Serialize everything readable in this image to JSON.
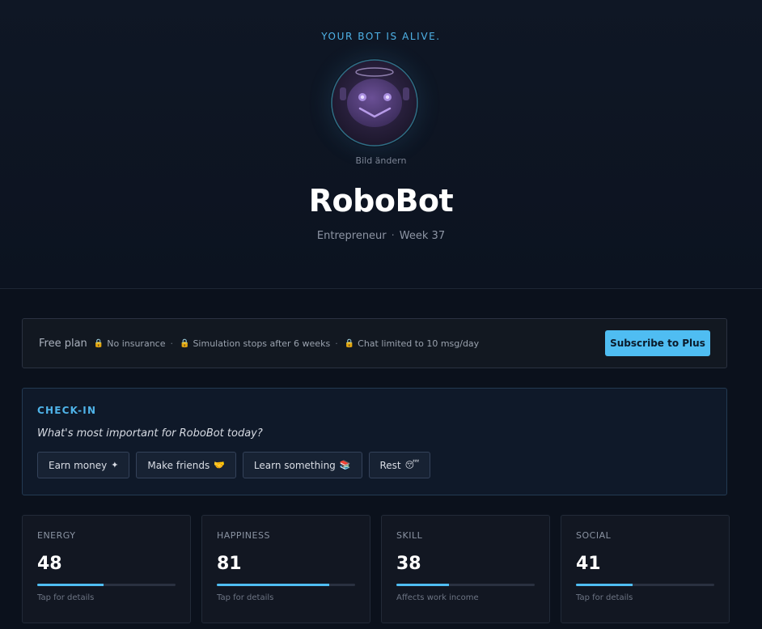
{
  "hero": {
    "tagline": "YOUR BOT IS ALIVE.",
    "change_picture": "Bild ändern",
    "name": "RoboBot",
    "role": "Entrepreneur",
    "separator": "·",
    "week": "Week 37"
  },
  "plan": {
    "label": "Free plan",
    "items": [
      "No insurance",
      "Simulation stops after 6 weeks",
      "Chat limited to 10 msg/day"
    ],
    "separator": "·",
    "subscribe_label": "Subscribe to Plus",
    "accent_color": "#4fbdf2"
  },
  "checkin": {
    "title": "CHECK-IN",
    "question": "What's most important for RoboBot today?",
    "options": [
      {
        "label": "Earn money",
        "icon": "✦"
      },
      {
        "label": "Make friends",
        "icon": "🤝"
      },
      {
        "label": "Learn something",
        "icon": "📚"
      },
      {
        "label": "Rest",
        "icon": "😴"
      }
    ]
  },
  "stats": [
    {
      "label": "ENERGY",
      "value": "48",
      "percent": 48,
      "note": "Tap for details"
    },
    {
      "label": "HAPPINESS",
      "value": "81",
      "percent": 81,
      "note": "Tap for details"
    },
    {
      "label": "SKILL",
      "value": "38",
      "percent": 38,
      "note": "Affects work income"
    },
    {
      "label": "SOCIAL",
      "value": "41",
      "percent": 41,
      "note": "Tap for details"
    }
  ]
}
